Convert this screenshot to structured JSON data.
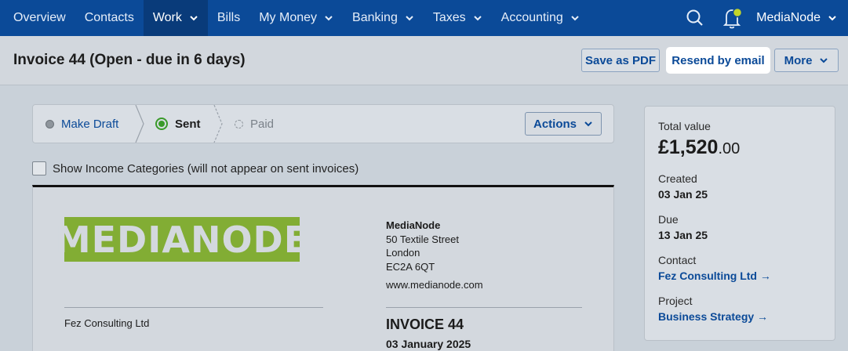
{
  "nav": {
    "items": [
      {
        "label": "Overview"
      },
      {
        "label": "Contacts"
      },
      {
        "label": "Work"
      },
      {
        "label": "Bills"
      },
      {
        "label": "My Money"
      },
      {
        "label": "Banking"
      },
      {
        "label": "Taxes"
      },
      {
        "label": "Accounting"
      }
    ],
    "active": "Work",
    "org_name": "MediaNode",
    "icons": [
      "search-icon",
      "bell-icon"
    ]
  },
  "header": {
    "title": "Invoice 44 (Open - due in 6 days)",
    "save_pdf": "Save as PDF",
    "resend_email": "Resend by email",
    "more": "More"
  },
  "status": {
    "make_draft": "Make Draft",
    "sent": "Sent",
    "paid": "Paid",
    "actions": "Actions"
  },
  "show_categories": "Show Income Categories (will not appear on sent invoices)",
  "invoice": {
    "logo_text": "MEDIANODE",
    "company": "MediaNode",
    "address1": "50 Textile Street",
    "address2": "London",
    "postcode": "EC2A 6QT",
    "website": "www.medianode.com",
    "bill_to": "Fez Consulting Ltd",
    "title": "INVOICE 44",
    "date": "03 January 2025"
  },
  "summary": {
    "total_label": "Total value",
    "total_main": "£1,520",
    "total_cents": ".00",
    "created_label": "Created",
    "created": "03 Jan 25",
    "due_label": "Due",
    "due": "13 Jan 25",
    "contact_label": "Contact",
    "contact": "Fez Consulting Ltd →",
    "project_label": "Project",
    "project": "Business Strategy →"
  },
  "colors": {
    "nav_bg": "#0b4a98",
    "link": "#0b4a98",
    "sent_green": "#3a9a2a",
    "logo_green": "#82ad34"
  }
}
